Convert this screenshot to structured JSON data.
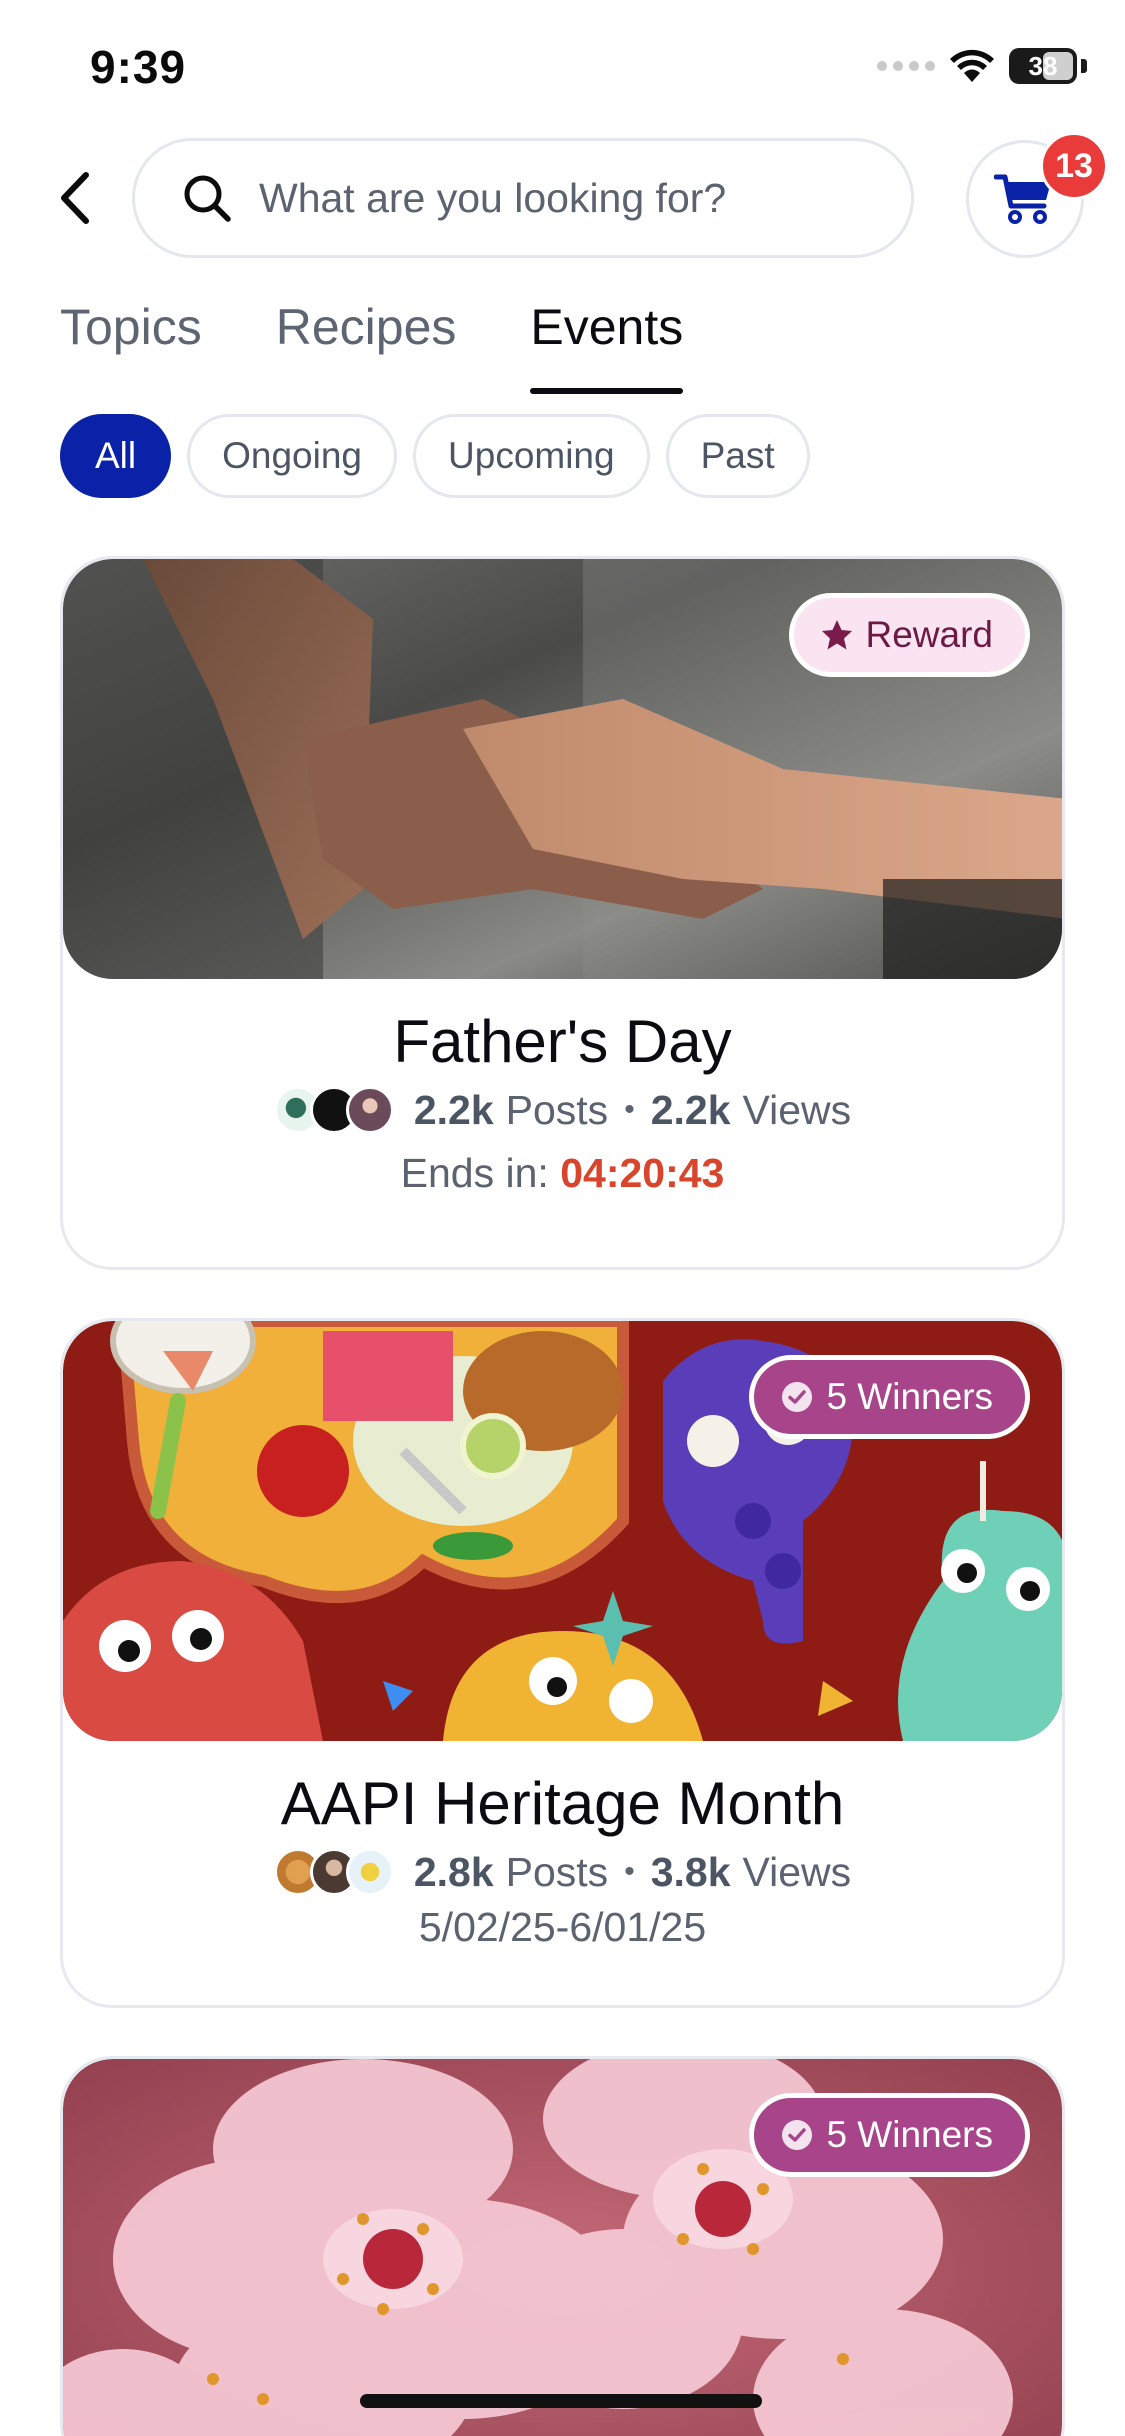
{
  "status_bar": {
    "time": "9:39",
    "battery": "38"
  },
  "search": {
    "placeholder": "What are you looking for?"
  },
  "cart": {
    "badge_count": "13"
  },
  "tabs": [
    {
      "label": "Topics",
      "active": false
    },
    {
      "label": "Recipes",
      "active": false
    },
    {
      "label": "Events",
      "active": true
    }
  ],
  "filters": [
    {
      "label": "All",
      "active": true
    },
    {
      "label": "Ongoing",
      "active": false
    },
    {
      "label": "Upcoming",
      "active": false
    },
    {
      "label": "Past",
      "active": false
    }
  ],
  "events": [
    {
      "title": "Father's Day",
      "badge": "Reward",
      "posts_count": "2.2k",
      "posts_label": "Posts",
      "views_count": "2.2k",
      "views_label": "Views",
      "ends_label": "Ends in:",
      "countdown": "04:20:43"
    },
    {
      "title": "AAPI Heritage Month",
      "badge": "5 Winners",
      "posts_count": "2.8k",
      "posts_label": "Posts",
      "views_count": "3.8k",
      "views_label": "Views",
      "date_range": "5/02/25-6/01/25"
    },
    {
      "badge": "5 Winners"
    }
  ],
  "colors": {
    "accent": "#0a22a8",
    "badge_red": "#ea3b3b",
    "countdown": "#d9442d",
    "winners_badge": "#a8458a",
    "reward_badge": "#fbe4f1"
  }
}
